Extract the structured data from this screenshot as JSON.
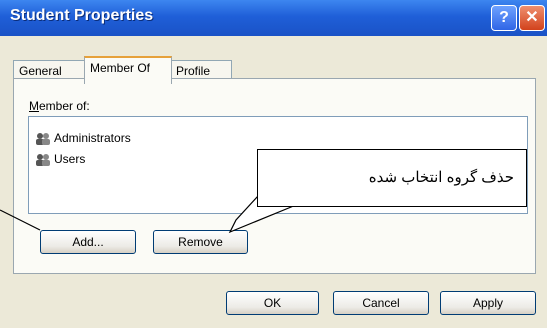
{
  "window": {
    "title": "Student Properties",
    "help_label": "?",
    "close_label": "✕"
  },
  "tabs": [
    {
      "label": "General"
    },
    {
      "label": "Member Of"
    },
    {
      "label": "Profile"
    }
  ],
  "member_of": {
    "label_prefix": "M",
    "label_rest": "ember of:",
    "items": [
      {
        "label": "Administrators",
        "icon": "group-icon"
      },
      {
        "label": "Users",
        "icon": "group-icon"
      }
    ]
  },
  "buttons": {
    "add": "Add...",
    "remove": "Remove",
    "ok": "OK",
    "cancel": "Cancel",
    "apply": "Apply"
  },
  "callout": {
    "text": "حذف گروه انتخاب شده"
  },
  "colors": {
    "titlebar": "#1f5fd8",
    "dialog": "#ece9d8",
    "close": "#d2421c",
    "accent_tab": "#e6a13a"
  }
}
